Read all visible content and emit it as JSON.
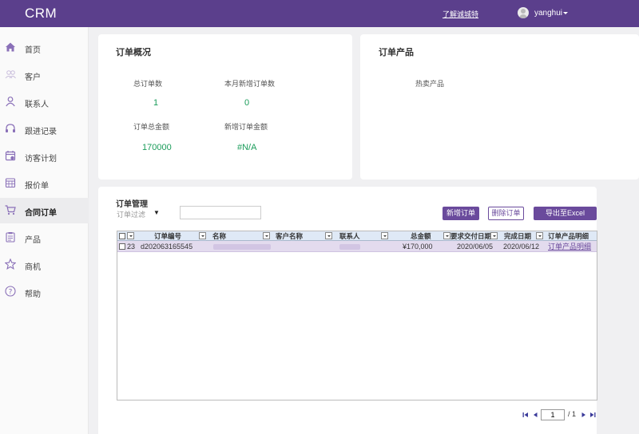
{
  "app": {
    "brand": "CRM",
    "learn_link": "了解诚城特",
    "user": "yanghui"
  },
  "sidebar": {
    "items": [
      {
        "label": "首页",
        "icon": "home-icon"
      },
      {
        "label": "客户",
        "icon": "customers-icon"
      },
      {
        "label": "联系人",
        "icon": "contact-icon"
      },
      {
        "label": "跟进记录",
        "icon": "headset-icon"
      },
      {
        "label": "访客计划",
        "icon": "calendar-icon"
      },
      {
        "label": "报价单",
        "icon": "quote-icon"
      },
      {
        "label": "合同订单",
        "icon": "cart-icon",
        "active": true
      },
      {
        "label": "产品",
        "icon": "clipboard-icon"
      },
      {
        "label": "商机",
        "icon": "star-icon"
      },
      {
        "label": "帮助",
        "icon": "help-icon"
      }
    ]
  },
  "overview": {
    "title": "订单概况",
    "total_count_label": "总订单数",
    "total_count": "1",
    "month_new_label": "本月新增订单数",
    "month_new": "0",
    "total_amount_label": "订单总金额",
    "total_amount": "170000",
    "new_amount_label": "新增订单金额",
    "new_amount": "#N/A"
  },
  "products": {
    "title": "订单产品",
    "hot_label": "热卖产品"
  },
  "orders": {
    "title": "订单管理",
    "filter_label": "订单过滤",
    "filter_value": "",
    "add_button": "新增订单",
    "delete_button": "删除订单",
    "export_button": "导出至Excel",
    "columns": [
      "订单编号",
      "名称",
      "客户名称",
      "联系人",
      "总金额",
      "要求交付日期",
      "完成日期",
      "订单产品明细"
    ],
    "rows": [
      {
        "row_no": "23",
        "order_no": "d202063165545",
        "name": "",
        "customer": "",
        "contact": "",
        "amount": "¥170,000",
        "due_date": "2020/06/05",
        "done_date": "2020/06/12",
        "detail_link": "订单产品明细"
      }
    ]
  },
  "pager": {
    "current_page": "1",
    "total_label": "/ 1"
  },
  "colors": {
    "brand": "#5b3f8c",
    "accent": "#6a4a9c",
    "value": "#1a9c5a"
  }
}
